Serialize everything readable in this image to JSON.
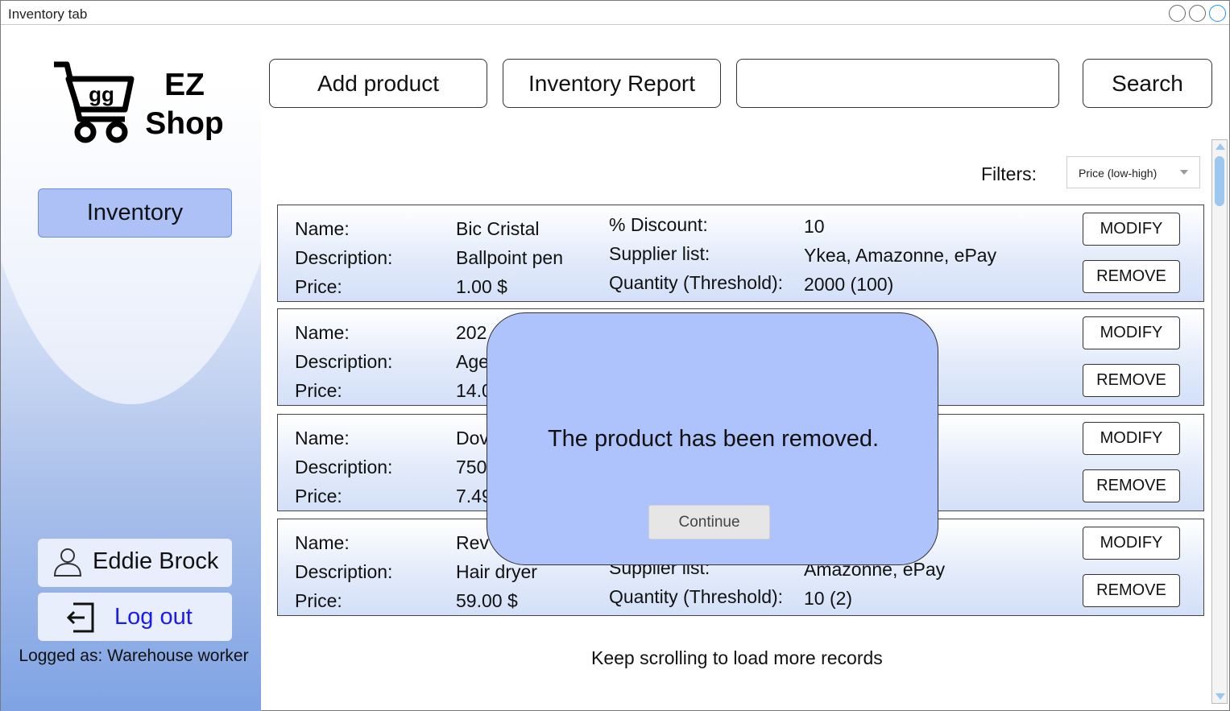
{
  "window": {
    "title": "Inventory tab"
  },
  "brand": {
    "line1": "EZ",
    "line2": "Shop",
    "cart_label": "gg"
  },
  "sidebar": {
    "nav_inventory": "Inventory",
    "user_name": "Eddie Brock",
    "logout": "Log out",
    "logged_as": "Logged as: Warehouse worker"
  },
  "toolbar": {
    "add_product": "Add product",
    "inventory_report": "Inventory Report",
    "search_value": "",
    "search": "Search"
  },
  "filters": {
    "label": "Filters:",
    "selected": "Price (low-high)"
  },
  "labels": {
    "name": "Name:",
    "description": "Description:",
    "price": "Price:",
    "discount": "% Discount:",
    "supplier": "Supplier list:",
    "quantity": "Quantity (Threshold):",
    "modify": "MODIFY",
    "remove": "REMOVE"
  },
  "products": [
    {
      "name": "Bic Cristal",
      "description": "Ballpoint pen",
      "price": "1.00 $",
      "discount": "10",
      "suppliers": "Ykea, Amazonne, ePay",
      "quantity": "2000 (100)"
    },
    {
      "name": "202",
      "description": "Age",
      "price": "14.0"
    },
    {
      "name": "Dov",
      "description": "750",
      "price": "7.49"
    },
    {
      "name": "Rev",
      "description": "Hair dryer",
      "price": "59.00 $",
      "suppliers": "Amazonne, ePay",
      "quantity": "10 (2)"
    }
  ],
  "list_footer": "Keep scrolling to load more records",
  "modal": {
    "message": "The product has been removed.",
    "button": "Continue"
  },
  "colors": {
    "accent": "#adc1f6",
    "modal_bg": "#aec3fb",
    "link": "#1a1aee"
  }
}
